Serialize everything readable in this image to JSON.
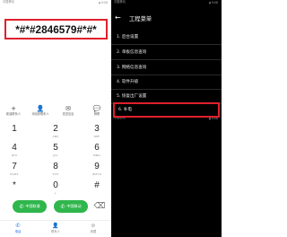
{
  "dialer": {
    "status": {
      "carrier": "中国移动",
      "icons": "▮ 9:08"
    },
    "number": "*#*#2846579#*#*",
    "toolbar": [
      {
        "icon": "+",
        "label": "新建联系人"
      },
      {
        "icon": "👤",
        "label": "添加到联系人"
      },
      {
        "icon": "✉",
        "label": "发送信息"
      },
      {
        "icon": "💬",
        "label": "畅联"
      }
    ],
    "keys": [
      {
        "digit": "1",
        "letters": ""
      },
      {
        "digit": "2",
        "letters": "ABC"
      },
      {
        "digit": "3",
        "letters": "DEF"
      },
      {
        "digit": "4",
        "letters": "GHI"
      },
      {
        "digit": "5",
        "letters": "JKL"
      },
      {
        "digit": "6",
        "letters": "MNO"
      },
      {
        "digit": "7",
        "letters": "PQRS"
      },
      {
        "digit": "8",
        "letters": "TUV"
      },
      {
        "digit": "9",
        "letters": "WXYZ"
      },
      {
        "digit": "*",
        "letters": ""
      },
      {
        "digit": "0",
        "letters": "+"
      },
      {
        "digit": "#",
        "letters": ""
      }
    ],
    "calls": [
      {
        "icon": "✆",
        "label": "中国联通"
      },
      {
        "icon": "✆",
        "label": "中国移动"
      }
    ],
    "backspace_icon": "⌫",
    "nav": [
      {
        "icon": "✆",
        "label": "电话"
      },
      {
        "icon": "👤",
        "label": "联系人"
      },
      {
        "icon": "☆",
        "label": "收藏"
      }
    ],
    "colors": {
      "highlight": "#e0202c",
      "call": "#2fb64c",
      "active": "#1a73e8"
    }
  },
  "eng_menu": {
    "status": {
      "carrier": "中国移动",
      "icons": "▮ 9:08"
    },
    "status2": {
      "carrier": "中国移动",
      "icons": "▮ 9:08"
    },
    "title": "工程菜单",
    "items": [
      "1. 后台设置",
      "2. 单板信息查询",
      "3. 网络信息查询",
      "4. 软件升级",
      "5. 恢复出厂设置",
      "6. 补电"
    ],
    "highlighted_index": 5,
    "colors": {
      "background": "#000000",
      "highlight": "#e0202c"
    }
  }
}
